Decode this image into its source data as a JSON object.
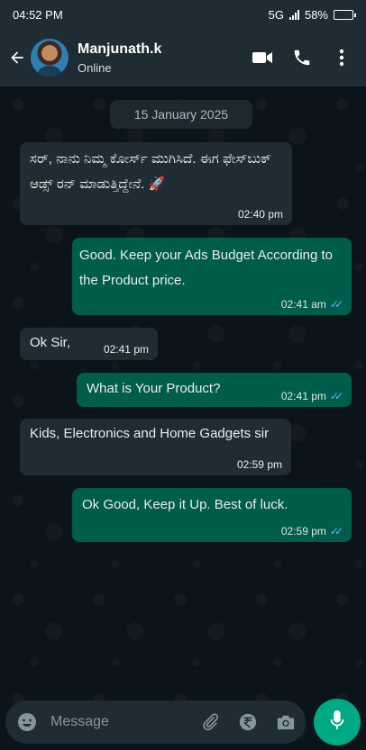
{
  "status_bar": {
    "time": "04:52 PM",
    "network": "5G",
    "battery": "58%",
    "battery_level": 0.58
  },
  "header": {
    "contact_name": "Manjunath.k",
    "contact_status": "Online"
  },
  "chat": {
    "date": "15 January 2025",
    "messages": [
      {
        "direction": "in",
        "text": "ಸರ್, ನಾನು ನಿಮ್ಮ ಕೋರ್ಸ್ ಮುಗಿಸಿದೆ. ಈಗ ಫೇಸ್‌ಬುಕ್ ಆಡ್ಸ್ ರನ್ ಮಾಡುತ್ತಿದ್ದೇನೆ.",
        "emoji": "🚀",
        "time": "02:40 pm"
      },
      {
        "direction": "out",
        "text": "Good. Keep your Ads Budget According to the Product price.",
        "time": "02:41 am"
      },
      {
        "direction": "in",
        "text": "Ok Sir,",
        "time": "02:41 pm"
      },
      {
        "direction": "out",
        "text": "What is Your Product?",
        "time": "02:41 pm"
      },
      {
        "direction": "in",
        "text": "Kids, Electronics and Home Gadgets sir",
        "time": "02:59 pm"
      },
      {
        "direction": "out",
        "text": "Ok Good, Keep it Up. Best of luck.",
        "time": "02:59 pm"
      }
    ]
  },
  "composer": {
    "placeholder": "Message"
  },
  "colors": {
    "header_bg": "#1f2c34",
    "chat_bg": "#0b141a",
    "incoming_bubble": "#1f2c34",
    "outgoing_bubble": "#005c4b",
    "accent": "#00a884",
    "read_ticks": "#53bdeb"
  }
}
